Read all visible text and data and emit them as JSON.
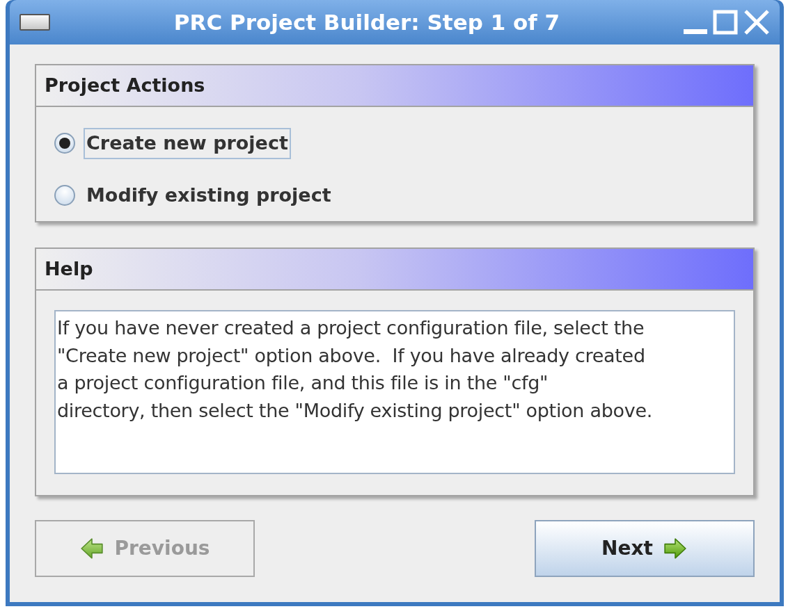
{
  "window": {
    "title": "PRC Project Builder: Step 1 of 7"
  },
  "actions_panel": {
    "title": "Project Actions",
    "options": [
      {
        "label": "Create new project",
        "selected": true,
        "focused": true
      },
      {
        "label": "Modify existing project",
        "selected": false,
        "focused": false
      }
    ]
  },
  "help_panel": {
    "title": "Help",
    "text": "If you have never created a project configuration file, select the\n\"Create new project\" option above.  If you have already created\na project configuration file, and this file is in the \"cfg\"\ndirectory, then select the \"Modify existing project\" option above."
  },
  "buttons": [
    {
      "kind": "previous",
      "label": "Previous",
      "disabled": true
    },
    {
      "kind": "next",
      "label": "Next",
      "disabled": false
    }
  ]
}
